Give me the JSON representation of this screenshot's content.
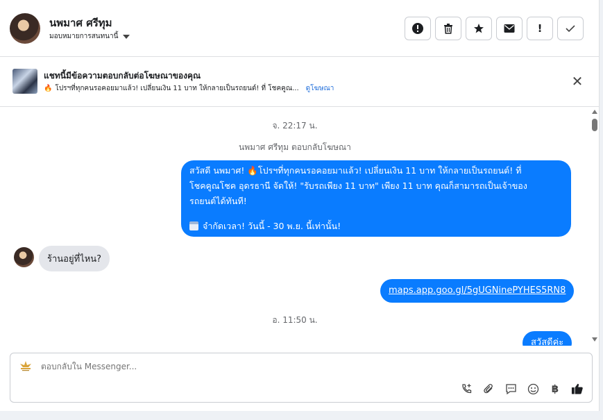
{
  "header": {
    "contact_name": "นพมาศ ศรีทุม",
    "assign_label": "มอบหมายการสนทนานี้",
    "actions": [
      {
        "name": "spam-icon",
        "glyph": "!"
      },
      {
        "name": "trash-icon",
        "glyph": "🗑"
      },
      {
        "name": "star-icon",
        "glyph": "★"
      },
      {
        "name": "mail-icon",
        "glyph": "✉"
      },
      {
        "name": "important-icon",
        "glyph": "!"
      },
      {
        "name": "done-icon",
        "glyph": "✓"
      }
    ]
  },
  "banner": {
    "title": "แชทนี้มีข้อความตอบกลับต่อโฆษณาของคุณ",
    "subtitle": "โปรฯที่ทุกคนรอคอยมาแล้ว! เปลี่ยนเงิน 11 บาท ให้กลายเป็นรถยนต์! ที่ โชคคูณ...",
    "link": "ดูโฆษณา"
  },
  "thread": {
    "timestamp_1": "จ. 22:17 น.",
    "reply_note": "นพมาศ ศรีทุม ตอบกลับโฆษณา",
    "ad_message_line1": "สวัสดี นพมาศ!  🔥โปรฯที่ทุกคนรอคอยมาแล้ว! เปลี่ยนเงิน 11 บาท ให้กลายเป็นรถยนต์! ที่",
    "ad_message_line2": "โชคคูณโชค อุดรธานี จัดให้! \"รับรถเพียง 11 บาท\" เพียง 11 บาท คุณก็สามารถเป็นเจ้าของ",
    "ad_message_line3": "รถยนต์ได้ทันที!",
    "ad_message_line4": "จำกัดเวลา! วันนี้ - 30 พ.ย. นี้เท่านั้น!",
    "incoming_message": "ร้านอยู่ที่ไหน?",
    "maps_link": "maps.app.goo.gl/5gUGNinePYHES5RN8",
    "timestamp_2": "อ. 11:50 น.",
    "last_message": "สวัสดีค่ะ"
  },
  "composer": {
    "placeholder": "ตอบกลับใน Messenger...",
    "tools": [
      "call-add-icon",
      "attach-icon",
      "saved-reply-icon",
      "emoji-icon",
      "baht-icon",
      "thumbs-up-icon"
    ]
  },
  "colors": {
    "outgoing_bubble": "#0a7cff",
    "incoming_bubble": "#e4e6eb",
    "link": "#216fdb"
  }
}
